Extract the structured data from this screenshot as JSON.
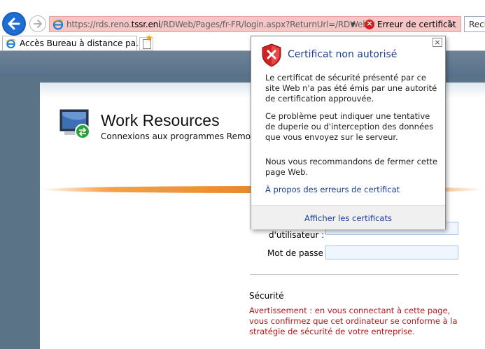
{
  "browser": {
    "url_prefix": "https://rds.reno.",
    "url_domain": "tssr.eni",
    "url_suffix": "/RDWeb/Pages/fr-FR/login.aspx?ReturnUrl=/RDWeb",
    "address_dropdown": "▼",
    "cert_error_label": "Erreur de certificat",
    "refresh_glyph": "↻",
    "search_placeholder": "Rech",
    "tab_title": "Accès Bureau à distance pa...",
    "tab_close": "×"
  },
  "page": {
    "title": "Work Resources",
    "subtitle": "Connexions aux programmes RemoteAp",
    "user_label": "d'utilisateur :",
    "password_label": "Mot de passe :",
    "security_heading": "Sécurité",
    "security_warning": "Avertissement : en vous connectant à cette page, vous confirmez que cet ordinateur se conforme à la stratégie de sécurité de votre entreprise."
  },
  "cert_popup": {
    "close": "×",
    "title": "Certificat non autorisé",
    "paragraph_1": "Le certificat de sécurité présenté par ce site Web n'a pas été émis par une autorité de certification approuvée.",
    "paragraph_2": "Ce problème peut indiquer une tentative de duperie ou d'interception des données que vous envoyez sur le serveur.",
    "paragraph_3": "Nous vous recommandons de fermer cette page Web.",
    "link": "À propos des erreurs de certificat",
    "show_certs": "Afficher les certificats"
  },
  "icons": {
    "back": "back-arrow-icon",
    "forward": "forward-arrow-icon",
    "ie": "ie-icon",
    "cert_error": "cert-error-icon",
    "refresh": "refresh-icon",
    "new_tab": "new-tab-icon",
    "remote_desktop": "remote-desktop-icon",
    "shield": "shield-error-icon"
  },
  "colors": {
    "address_error_bg": "#f6c6c6",
    "link_blue": "#1a3f9a",
    "warning_red": "#b5161d",
    "accent_orange": "#e7872a"
  }
}
